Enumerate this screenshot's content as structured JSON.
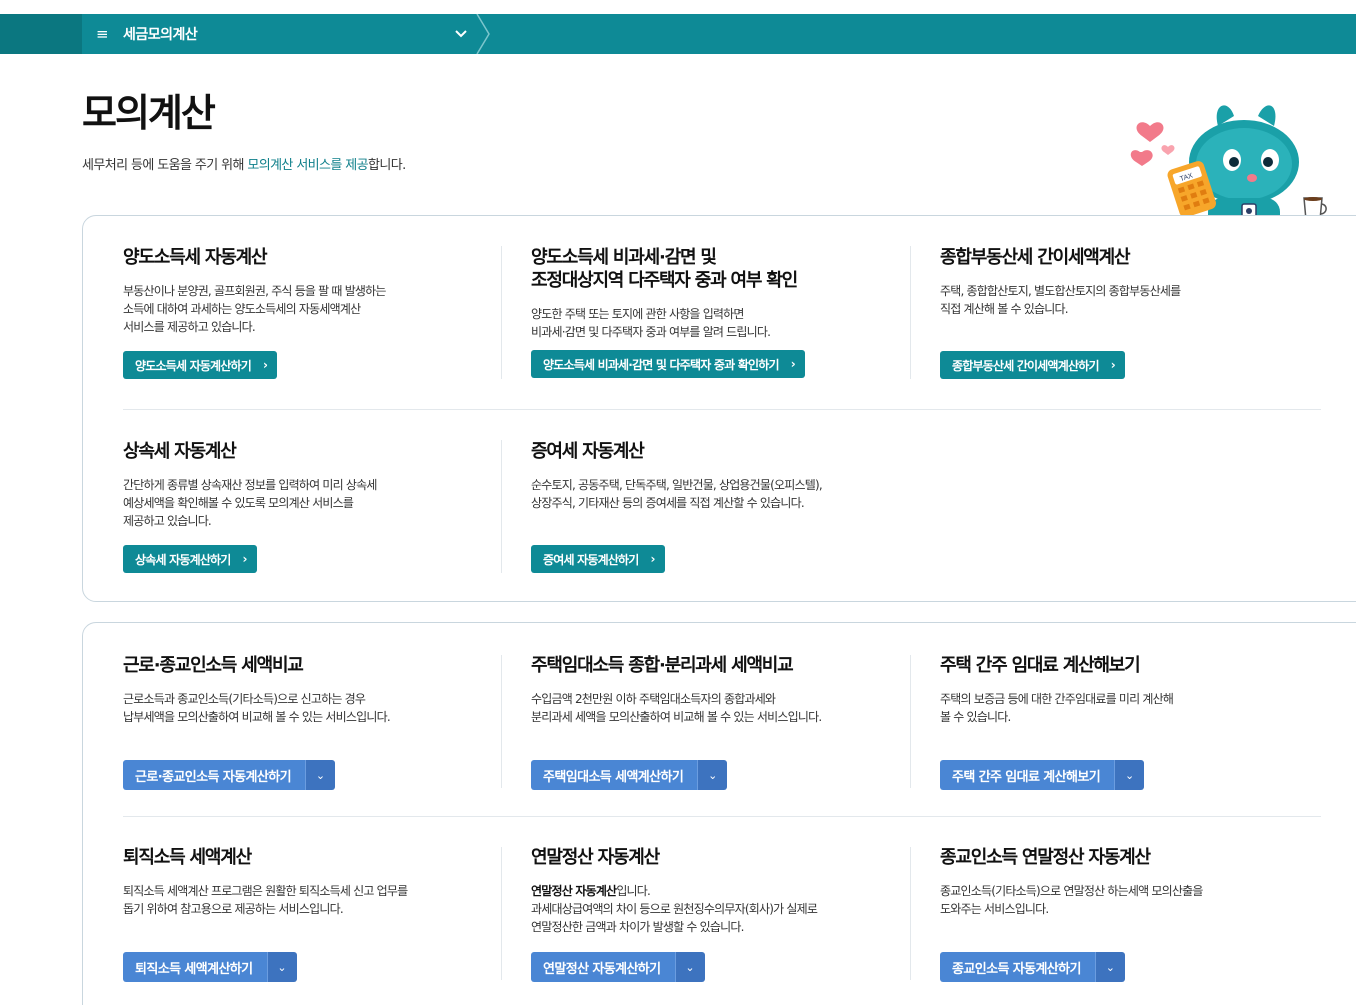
{
  "nav": {
    "menu_title": "세금모의계산"
  },
  "page": {
    "title": "모의계산",
    "desc_pre": "세무처리 등에 도움을 주기 위해 ",
    "desc_highlight": "모의계산 서비스를 제공",
    "desc_post": "합니다."
  },
  "mascot": {
    "tax_label": "TAX"
  },
  "group1": {
    "cards": [
      {
        "title": "양도소득세 자동계산",
        "desc": "부동산이나 분양권, 골프회원권, 주식 등을 팔 때 발생하는\n소득에 대하여 과세하는 양도소득세의 자동세액계산\n서비스를 제공하고 있습니다.",
        "button": "양도소득세 자동계산하기"
      },
      {
        "title": "양도소득세 비과세·감면 및\n조정대상지역 다주택자 중과 여부 확인",
        "desc": "양도한 주택 또는 토지에 관한 사항을 입력하면\n비과세·감면 및 다주택자 중과 여부를 알려 드립니다.",
        "button": "양도소득세 비과세·감면 및 다주택자 중과 확인하기"
      },
      {
        "title": "종합부동산세 간이세액계산",
        "desc": "주택, 종합합산토지, 별도합산토지의 종합부동산세를\n직접 계산해 볼 수 있습니다.",
        "button": "종합부동산세 간이세액계산하기"
      },
      {
        "title": "상속세 자동계산",
        "desc": "간단하게 종류별 상속재산 정보를 입력하여 미리 상속세\n예상세액을 확인해볼 수 있도록 모의계산 서비스를\n제공하고 있습니다.",
        "button": "상속세 자동계산하기"
      },
      {
        "title": "증여세 자동계산",
        "desc": "순수토지, 공동주택, 단독주택, 일반건물, 상업용건물(오피스텔),\n상장주식, 기타재산 등의 증여세를 직접 계산할 수 있습니다.",
        "button": "증여세 자동계산하기"
      }
    ]
  },
  "group2": {
    "cards": [
      {
        "title": "근로·종교인소득 세액비교",
        "desc": "근로소득과 종교인소득(기타소득)으로 신고하는 경우\n납부세액을 모의산출하여 비교해 볼 수 있는 서비스입니다.",
        "button": "근로·종교인소득 자동계산하기"
      },
      {
        "title": "주택임대소득 종합·분리과세 세액비교",
        "desc": "수입금액 2천만원 이하 주택임대소득자의 종합과세와\n분리과세 세액을 모의산출하여 비교해 볼 수 있는 서비스입니다.",
        "button": "주택임대소득 세액계산하기"
      },
      {
        "title": "주택 간주 임대료 계산해보기",
        "desc": "주택의 보증금 등에 대한 간주임대료를 미리 계산해\n볼 수 있습니다.",
        "button": "주택 간주 임대료 계산해보기"
      },
      {
        "title": "퇴직소득 세액계산",
        "desc": "퇴직소득 세액계산 프로그램은 원활한 퇴직소득세 신고 업무를\n돕기 위하여 참고용으로 제공하는 서비스입니다.",
        "button": "퇴직소득 세액계산하기"
      },
      {
        "title": "연말정산 자동계산",
        "desc_bold": "연말정산 자동계산",
        "desc_bold_tail": "입니다.",
        "desc": "과세대상급여액의 차이 등으로 원천징수의무자(회사)가 실제로\n연말정산한 금액과 차이가 발생할 수 있습니다.",
        "button": "연말정산 자동계산하기"
      },
      {
        "title": "종교인소득 연말정산 자동계산",
        "desc": "종교인소득(기타소득)으로 연말정산 하는세액 모의산출을\n도와주는 서비스입니다.",
        "button": "종교인소득 자동계산하기"
      }
    ]
  }
}
